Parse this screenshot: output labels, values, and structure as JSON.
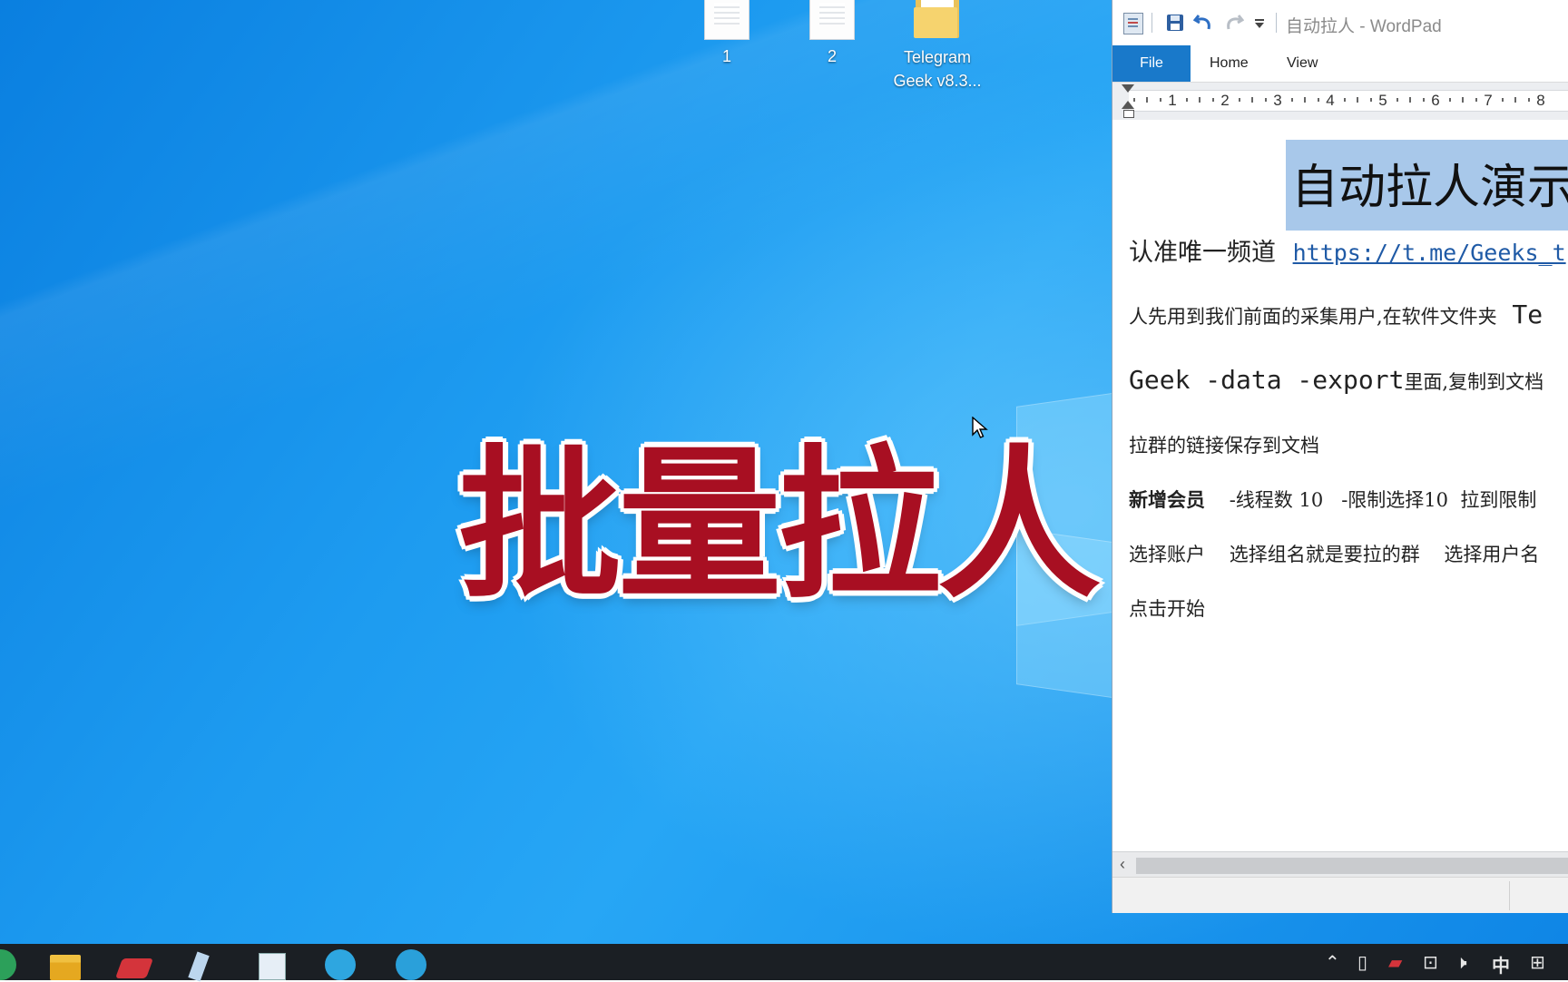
{
  "desktop": {
    "icons": [
      {
        "label": "1"
      },
      {
        "label": "2"
      },
      {
        "label": "Telegram\nGeek v8.3..."
      }
    ],
    "overlay_title": "批量拉人"
  },
  "wordpad": {
    "title": "自动拉人 - WordPad",
    "tabs": {
      "file": "File",
      "home": "Home",
      "view": "View"
    },
    "ruler": [
      "1",
      "2",
      "3",
      "4",
      "5",
      "6",
      "7",
      "8"
    ],
    "document": {
      "heading": "自动拉人演示",
      "line1_text": "认准唯一频道",
      "line1_link": "https://t.me/Geeks_t",
      "line2": "人先用到我们前面的采集用户,在软件文件夹",
      "line2_tail": "Te",
      "line3_mono": "Geek -data -export",
      "line3_tail": "里面,复制到文档",
      "line4": "拉群的链接保存到文档",
      "line5_bold": "新增会员",
      "line5_rest": "-线程数 10   -限制选择10  拉到限制",
      "line6": "选择账户    选择组名就是要拉的群    选择用户名",
      "line7": "点击开始"
    }
  },
  "tray": {
    "ime": "中"
  }
}
